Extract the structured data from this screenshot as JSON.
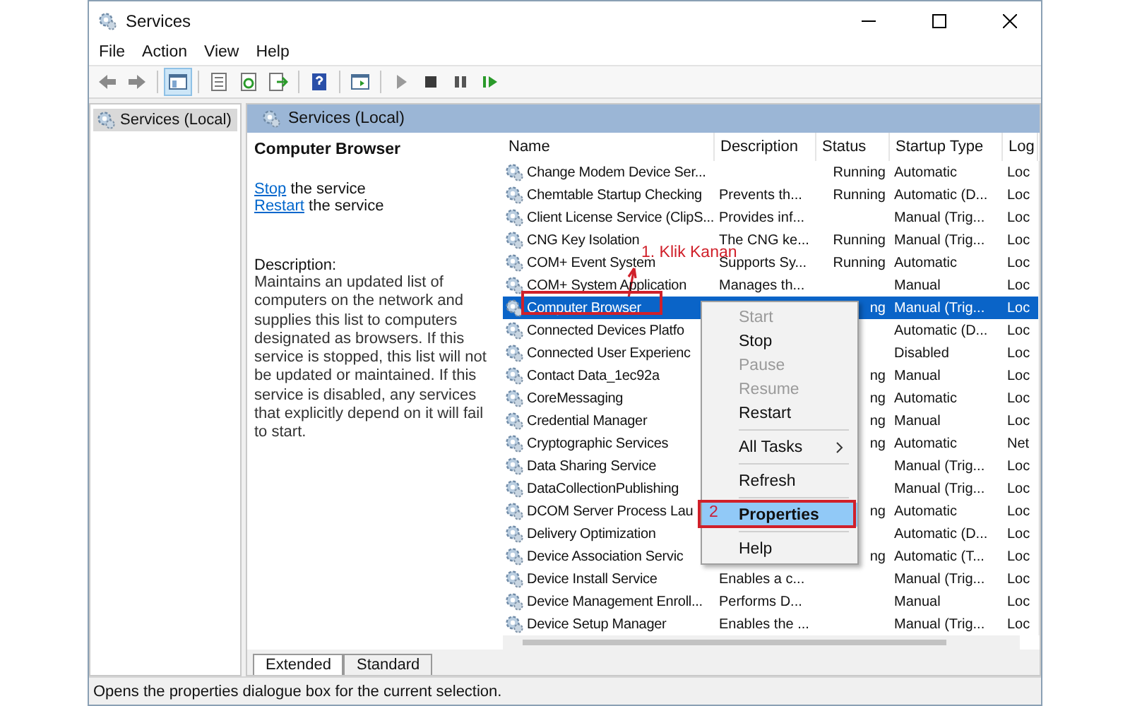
{
  "window": {
    "title": "Services"
  },
  "menu_bar": [
    "File",
    "Action",
    "View",
    "Help"
  ],
  "tree": {
    "items": [
      {
        "label": "Services (Local)",
        "selected": true
      }
    ]
  },
  "panel_header": "Services (Local)",
  "details": {
    "title": "Computer Browser",
    "actions": [
      {
        "link": "Stop",
        "text": "the service"
      },
      {
        "link": "Restart",
        "text": "the service"
      }
    ],
    "description_label": "Description:",
    "description": "Maintains an updated list of computers on the network and supplies this list to computers designated as browsers. If this service is stopped, this list will not be updated or maintained. If this service is disabled, any services that explicitly depend on it will fail to start."
  },
  "table": {
    "columns": [
      "Name",
      "Description",
      "Status",
      "Startup Type",
      "Log"
    ],
    "rows": [
      {
        "name": "Change Modem Device Ser...",
        "status": "Running",
        "startup": "Automatic",
        "logon": "Loc",
        "selected": false
      },
      {
        "name": "Chemtable Startup Checking",
        "description": "Prevents th...",
        "status": "Running",
        "startup": "Automatic (D...",
        "logon": "Loc",
        "selected": false
      },
      {
        "name": "Client License Service (ClipS...",
        "description": "Provides inf...",
        "startup": "Manual (Trig...",
        "logon": "Loc",
        "selected": false
      },
      {
        "name": "CNG Key Isolation",
        "description": "The CNG ke...",
        "status": "Running",
        "startup": "Manual (Trig...",
        "logon": "Loc",
        "selected": false
      },
      {
        "name": "COM+ Event System",
        "description": "Supports Sy...",
        "status": "Running",
        "startup": "Automatic",
        "logon": "Loc",
        "selected": false
      },
      {
        "name": "COM+ System Application",
        "description": "Manages th...",
        "startup": "Manual",
        "logon": "Loc",
        "selected": false
      },
      {
        "name": "Computer Browser",
        "status": "ng",
        "startup": "Manual (Trig...",
        "logon": "Loc",
        "selected": true
      },
      {
        "name": "Connected Devices Platfo",
        "startup": "Automatic (D...",
        "logon": "Loc",
        "selected": false
      },
      {
        "name": "Connected User Experienc",
        "startup": "Disabled",
        "logon": "Loc",
        "selected": false
      },
      {
        "name": "Contact Data_1ec92a",
        "status": "ng",
        "startup": "Manual",
        "logon": "Loc",
        "selected": false
      },
      {
        "name": "CoreMessaging",
        "status": "ng",
        "startup": "Automatic",
        "logon": "Loc",
        "selected": false
      },
      {
        "name": "Credential Manager",
        "status": "ng",
        "startup": "Manual",
        "logon": "Loc",
        "selected": false
      },
      {
        "name": "Cryptographic Services",
        "status": "ng",
        "startup": "Automatic",
        "logon": "Net",
        "selected": false
      },
      {
        "name": "Data Sharing Service",
        "startup": "Manual (Trig...",
        "logon": "Loc",
        "selected": false
      },
      {
        "name": "DataCollectionPublishing",
        "startup": "Manual (Trig...",
        "logon": "Loc",
        "selected": false
      },
      {
        "name": "DCOM Server Process Lau",
        "status": "ng",
        "startup": "Automatic",
        "logon": "Loc",
        "selected": false
      },
      {
        "name": "Delivery Optimization",
        "startup": "Automatic (D...",
        "logon": "Loc",
        "selected": false
      },
      {
        "name": "Device Association Servic",
        "status": "ng",
        "startup": "Automatic (T...",
        "logon": "Loc",
        "selected": false
      },
      {
        "name": "Device Install Service",
        "description": "Enables a c...",
        "startup": "Manual (Trig...",
        "logon": "Loc",
        "selected": false
      },
      {
        "name": "Device Management Enroll...",
        "description": "Performs D...",
        "startup": "Manual",
        "logon": "Loc",
        "selected": false
      },
      {
        "name": "Device Setup Manager",
        "description": "Enables the ...",
        "startup": "Manual (Trig...",
        "logon": "Loc",
        "selected": false
      }
    ]
  },
  "context_menu": {
    "items": [
      {
        "kind": "item",
        "label": "Start",
        "disabled": true,
        "selected": false
      },
      {
        "kind": "item",
        "label": "Stop",
        "disabled": false,
        "selected": false
      },
      {
        "kind": "item",
        "label": "Pause",
        "disabled": true,
        "selected": false
      },
      {
        "kind": "item",
        "label": "Resume",
        "disabled": true,
        "selected": false
      },
      {
        "kind": "item",
        "label": "Restart",
        "disabled": false,
        "selected": false
      },
      {
        "kind": "separator"
      },
      {
        "kind": "submenu",
        "label": "All Tasks",
        "disabled": false,
        "selected": false
      },
      {
        "kind": "separator"
      },
      {
        "kind": "item",
        "label": "Refresh",
        "disabled": false,
        "selected": false
      },
      {
        "kind": "separator"
      },
      {
        "kind": "item",
        "label": "Properties",
        "disabled": false,
        "selected": true
      },
      {
        "kind": "separator"
      },
      {
        "kind": "item",
        "label": "Help",
        "disabled": false,
        "selected": false
      }
    ]
  },
  "annotations": [
    {
      "kind": "callout",
      "text": "1. Klik Kanan"
    },
    {
      "kind": "step",
      "text": "2"
    }
  ],
  "view_tabs": [
    {
      "label": "Extended",
      "selected": true
    },
    {
      "label": "Standard",
      "selected": false
    }
  ],
  "status_bar": "Opens the properties dialogue box for the current selection."
}
